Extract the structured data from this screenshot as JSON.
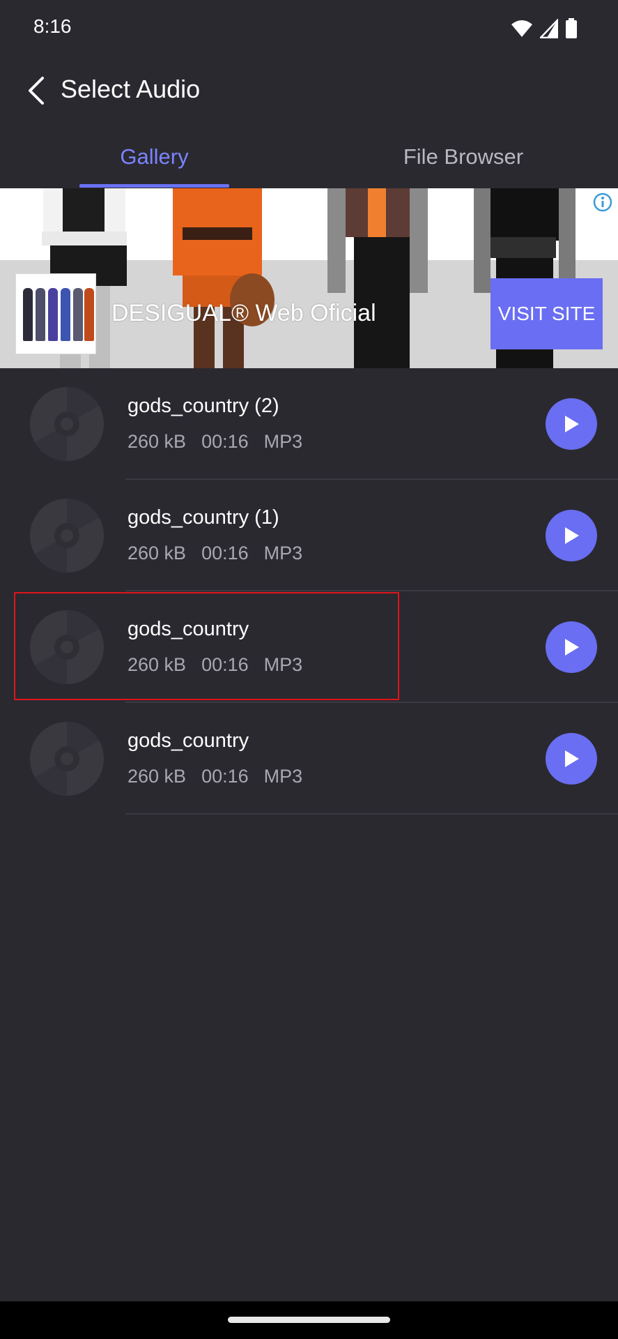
{
  "status_bar": {
    "time": "8:16"
  },
  "app_bar": {
    "title": "Select Audio"
  },
  "tabs": [
    {
      "label": "Gallery",
      "selected": true
    },
    {
      "label": "File Browser",
      "selected": false
    }
  ],
  "ad": {
    "text": "DESIGUAL® Web Oficial",
    "button_label": "VISIT SITE"
  },
  "audio_items": [
    {
      "name": "gods_country (2)",
      "size": "260 kB",
      "duration": "00:16",
      "format": "MP3"
    },
    {
      "name": "gods_country (1)",
      "size": "260 kB",
      "duration": "00:16",
      "format": "MP3"
    },
    {
      "name": "gods_country",
      "size": "260 kB",
      "duration": "00:16",
      "format": "MP3"
    },
    {
      "name": "gods_country",
      "size": "260 kB",
      "duration": "00:16",
      "format": "MP3"
    }
  ],
  "colors": {
    "background": "#2a2930",
    "accent": "#6a6ef2",
    "tab_active": "#7b84ff",
    "highlight": "#e0141c"
  }
}
